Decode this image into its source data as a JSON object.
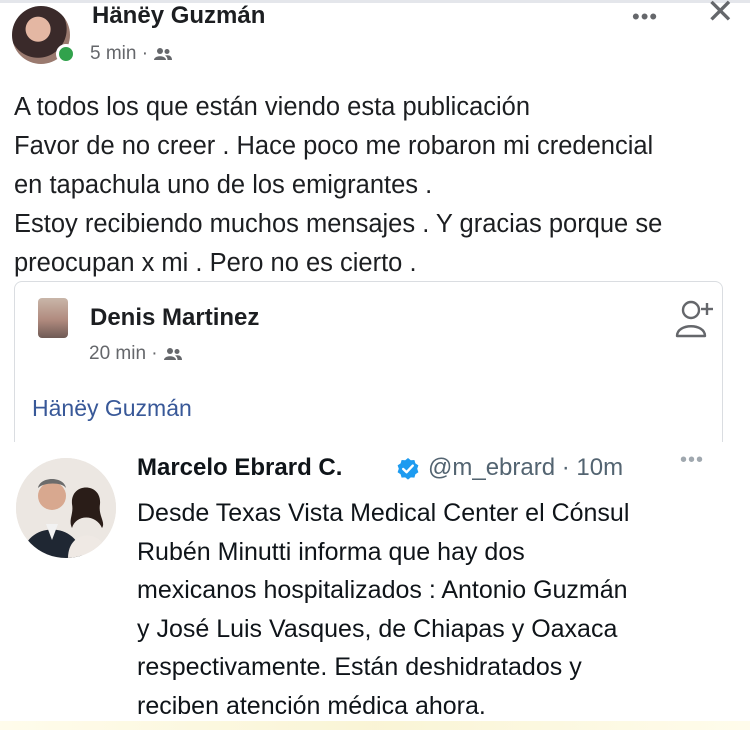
{
  "post": {
    "author": "Hänëy Guzmán",
    "time": "5 min ·",
    "more_label": "•••",
    "close_label": "✕",
    "lines": [
      "A todos los que están viendo esta publicación",
      "Favor de no creer . Hace poco me robaron mi credencial",
      "en tapachula uno de los emigrantes .",
      "Estoy recibiendo muchos mensajes . Y gracias porque se",
      "preocupan x mi . Pero no es cierto ."
    ]
  },
  "shared": {
    "author": "Denis Martinez",
    "time": "20 min ·",
    "tagged": "Hänëy Guzmán"
  },
  "tweet": {
    "name": "Marcelo Ebrard C.",
    "handle_time": "@m_ebrard · 10m",
    "more_label": "•••",
    "lines": [
      "Desde Texas Vista Medical Center el Cónsul",
      "Rubén Minutti informa que hay dos",
      "mexicanos hospitalizados : Antonio Guzmán",
      "y José Luis Vasques, de Chiapas y Oaxaca",
      "respectivamente. Están deshidratados y",
      "reciben atención médica ahora."
    ]
  },
  "icons": {
    "friends": "friends-icon",
    "add_friend": "add-friend-icon",
    "verified": "verified-badge-icon"
  },
  "colors": {
    "link": "#385898",
    "online": "#31a24c",
    "verified": "#1d9bf0",
    "meta": "#65676b"
  }
}
